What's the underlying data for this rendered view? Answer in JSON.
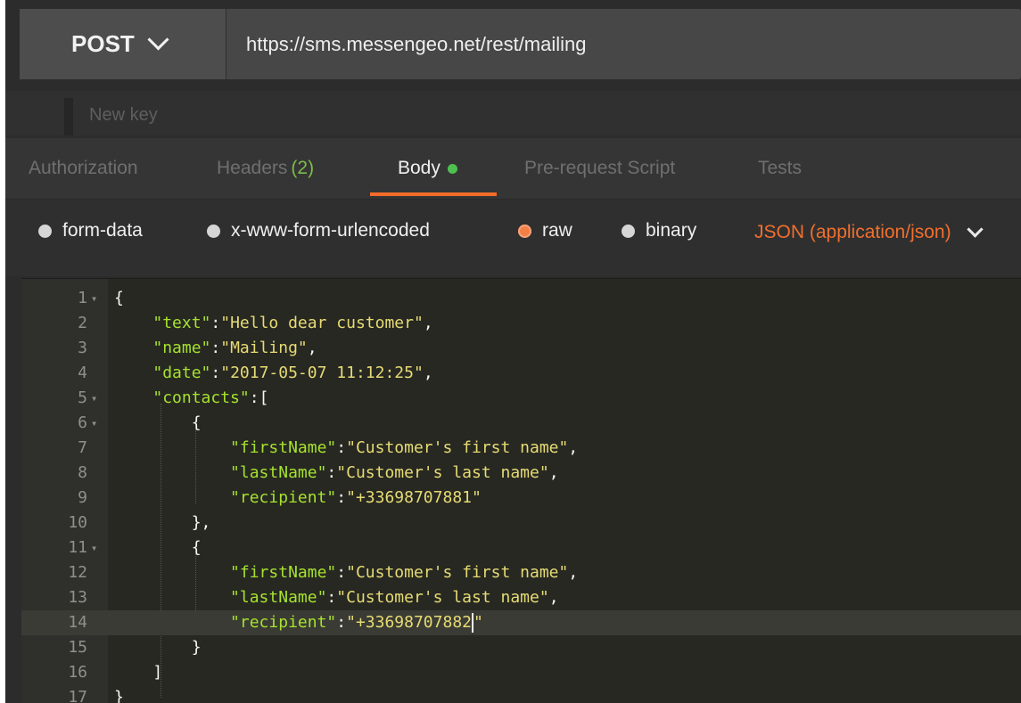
{
  "request": {
    "method": "POST",
    "url": "https://sms.messengeo.net/rest/mailing"
  },
  "params": {
    "key_placeholder": "New key"
  },
  "tabs": [
    {
      "label": "Authorization"
    },
    {
      "label": "Headers",
      "count": "(2)"
    },
    {
      "label": "Body"
    },
    {
      "label": "Pre-request Script"
    },
    {
      "label": "Tests"
    }
  ],
  "body_modes": {
    "form_data": "form-data",
    "urlencoded": "x-www-form-urlencoded",
    "raw": "raw",
    "binary": "binary",
    "selected": "raw",
    "content_type": "JSON (application/json)"
  },
  "editor": {
    "lines": [
      {
        "n": "1",
        "fold": true,
        "tokens": [
          [
            "p",
            "{"
          ]
        ]
      },
      {
        "n": "2",
        "fold": false,
        "tokens": [
          [
            "p",
            "    "
          ],
          [
            "k",
            "\"text\""
          ],
          [
            "p",
            ":"
          ],
          [
            "s",
            "\"Hello dear customer\""
          ],
          [
            "p",
            ","
          ]
        ]
      },
      {
        "n": "3",
        "fold": false,
        "tokens": [
          [
            "p",
            "    "
          ],
          [
            "k",
            "\"name\""
          ],
          [
            "p",
            ":"
          ],
          [
            "s",
            "\"Mailing\""
          ],
          [
            "p",
            ","
          ]
        ]
      },
      {
        "n": "4",
        "fold": false,
        "tokens": [
          [
            "p",
            "    "
          ],
          [
            "k",
            "\"date\""
          ],
          [
            "p",
            ":"
          ],
          [
            "s",
            "\"2017-05-07 11:12:25\""
          ],
          [
            "p",
            ","
          ]
        ]
      },
      {
        "n": "5",
        "fold": true,
        "tokens": [
          [
            "p",
            "    "
          ],
          [
            "k",
            "\"contacts\""
          ],
          [
            "p",
            ":["
          ]
        ]
      },
      {
        "n": "6",
        "fold": true,
        "tokens": [
          [
            "p",
            "        {"
          ]
        ]
      },
      {
        "n": "7",
        "fold": false,
        "tokens": [
          [
            "p",
            "            "
          ],
          [
            "k",
            "\"firstName\""
          ],
          [
            "p",
            ":"
          ],
          [
            "s",
            "\"Customer's first name\""
          ],
          [
            "p",
            ","
          ]
        ]
      },
      {
        "n": "8",
        "fold": false,
        "tokens": [
          [
            "p",
            "            "
          ],
          [
            "k",
            "\"lastName\""
          ],
          [
            "p",
            ":"
          ],
          [
            "s",
            "\"Customer's last name\""
          ],
          [
            "p",
            ","
          ]
        ]
      },
      {
        "n": "9",
        "fold": false,
        "tokens": [
          [
            "p",
            "            "
          ],
          [
            "k",
            "\"recipient\""
          ],
          [
            "p",
            ":"
          ],
          [
            "s",
            "\"+33698707881\""
          ]
        ]
      },
      {
        "n": "10",
        "fold": false,
        "tokens": [
          [
            "p",
            "        },"
          ]
        ]
      },
      {
        "n": "11",
        "fold": true,
        "tokens": [
          [
            "p",
            "        {"
          ]
        ]
      },
      {
        "n": "12",
        "fold": false,
        "tokens": [
          [
            "p",
            "            "
          ],
          [
            "k",
            "\"firstName\""
          ],
          [
            "p",
            ":"
          ],
          [
            "s",
            "\"Customer's first name\""
          ],
          [
            "p",
            ","
          ]
        ]
      },
      {
        "n": "13",
        "fold": false,
        "tokens": [
          [
            "p",
            "            "
          ],
          [
            "k",
            "\"lastName\""
          ],
          [
            "p",
            ":"
          ],
          [
            "s",
            "\"Customer's last name\""
          ],
          [
            "p",
            ","
          ]
        ]
      },
      {
        "n": "14",
        "fold": false,
        "current": true,
        "tokens": [
          [
            "p",
            "            "
          ],
          [
            "k",
            "\"recipient\""
          ],
          [
            "p",
            ":"
          ],
          [
            "s",
            "\"+33698707882"
          ],
          [
            "cursor",
            ""
          ],
          [
            "s",
            "\""
          ]
        ]
      },
      {
        "n": "15",
        "fold": false,
        "tokens": [
          [
            "p",
            "        }"
          ]
        ]
      },
      {
        "n": "16",
        "fold": false,
        "tokens": [
          [
            "p",
            "    ]"
          ]
        ]
      },
      {
        "n": "17",
        "fold": false,
        "tokens": [
          [
            "p",
            "}"
          ]
        ]
      }
    ]
  },
  "colors": {
    "accent": "#f36c2a",
    "body_dot": "#4fc04f",
    "json_key": "#a6e22e",
    "json_string": "#e6db74"
  }
}
